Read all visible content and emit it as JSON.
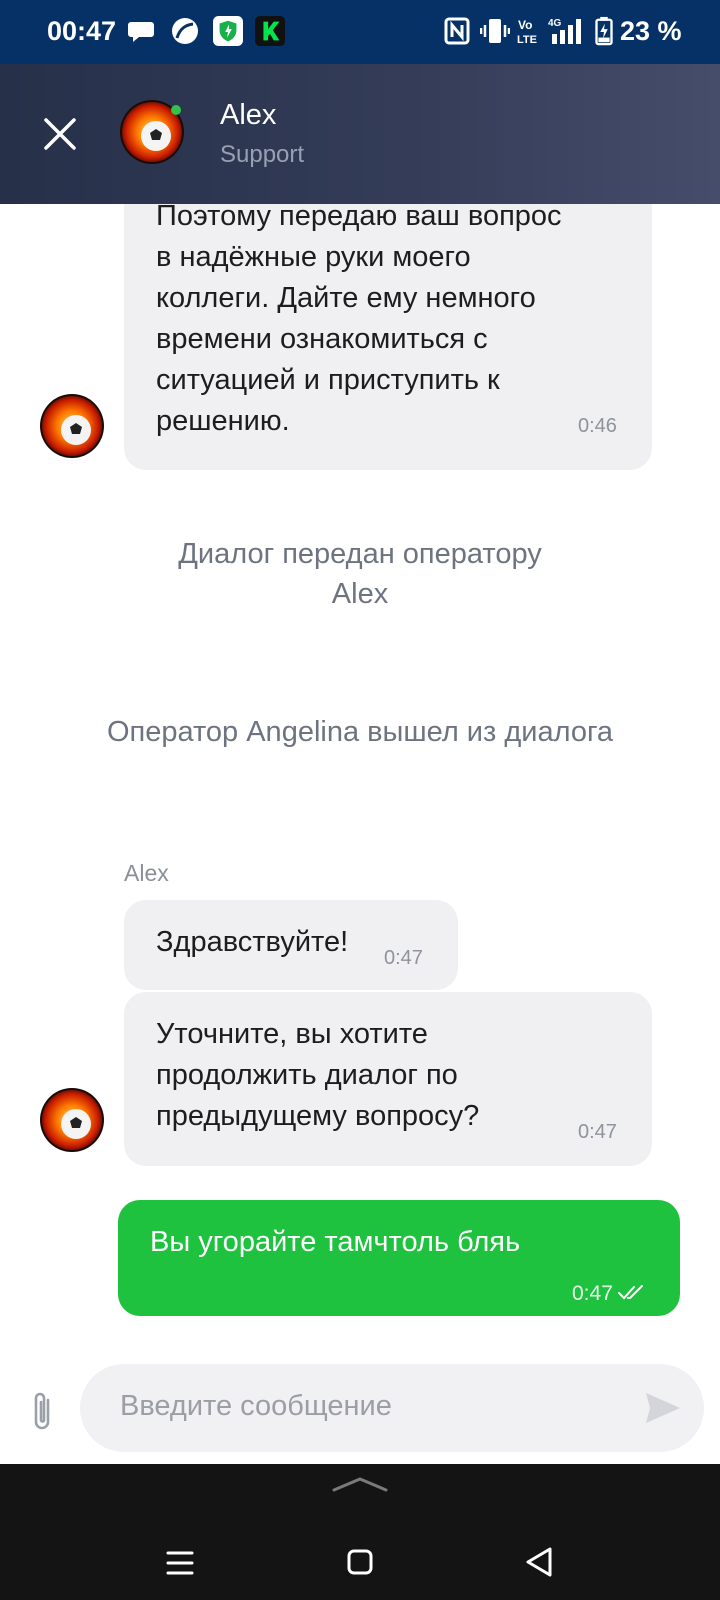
{
  "status_bar": {
    "time": "00:47",
    "battery_text": "23 %",
    "icons": [
      "chat-icon",
      "leaf-icon",
      "shield-app-icon",
      "kaspersky-k-icon",
      "nfc-icon",
      "vibrate-icon",
      "volte-icon",
      "4g-signal-icon",
      "battery-icon"
    ]
  },
  "header": {
    "name": "Alex",
    "subtitle": "Support",
    "online": true
  },
  "messages": {
    "m1_lines": [
      "Поэтому передаю ваш вопрос",
      "в надёжные руки моего",
      "коллеги. Дайте ему немного",
      "времени ознакомиться с",
      "ситуацией и приступить к",
      "решению."
    ],
    "m1_time": "0:46",
    "sys1_line1": "Диалог передан оператору",
    "sys1_line2": "Alex",
    "sys2": "Оператор Angelina вышел из диалога",
    "sender": "Alex",
    "m2_text": "Здравствуйте!",
    "m2_time": "0:47",
    "m3_lines": [
      "Уточните, вы хотите",
      "продолжить диалог по",
      "предыдущему вопросу?"
    ],
    "m3_time": "0:47",
    "out_text": "Вы угорайте тамчтоль бляь",
    "out_time": "0:47",
    "out_status": "read"
  },
  "input": {
    "placeholder": "Введите сообщение"
  },
  "colors": {
    "status_bar": "#063166",
    "header": "#2f3752",
    "incoming_bubble": "#f0f0f2",
    "outgoing_bubble": "#1ec23e",
    "system_text": "#6d7480"
  }
}
